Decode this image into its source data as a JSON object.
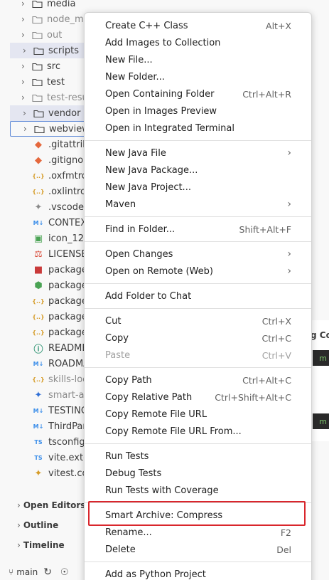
{
  "explorer": {
    "rows": [
      {
        "label": "media",
        "kind": "folder",
        "dim": false
      },
      {
        "label": "node_m",
        "kind": "folder",
        "dim": true
      },
      {
        "label": "out",
        "kind": "folder",
        "dim": true
      },
      {
        "label": "scripts",
        "kind": "folder",
        "dim": false,
        "selected": true
      },
      {
        "label": "src",
        "kind": "folder",
        "dim": false
      },
      {
        "label": "test",
        "kind": "folder",
        "dim": false
      },
      {
        "label": "test-resu",
        "kind": "folder",
        "dim": true
      },
      {
        "label": "vendor",
        "kind": "folder",
        "dim": false,
        "selected": true
      },
      {
        "label": "webview",
        "kind": "folder",
        "dim": false,
        "focused": true
      },
      {
        "label": ".gitattrib",
        "kind": "file",
        "icon": "git",
        "color": "#e5683d"
      },
      {
        "label": ".gitignor",
        "kind": "file",
        "icon": "git",
        "color": "#e5683d"
      },
      {
        "label": ".oxfmtrc",
        "kind": "file",
        "icon": "json",
        "color": "#d69c28"
      },
      {
        "label": ".oxlintrc.",
        "kind": "file",
        "icon": "json",
        "color": "#d69c28"
      },
      {
        "label": ".vscodeig",
        "kind": "file",
        "icon": "vscode",
        "color": "#8a8a8a"
      },
      {
        "label": "CONTEX",
        "kind": "file",
        "icon": "md",
        "color": "#3b8eea"
      },
      {
        "label": "icon_128",
        "kind": "file",
        "icon": "image",
        "color": "#4aa354"
      },
      {
        "label": "LICENSE",
        "kind": "file",
        "icon": "license",
        "color": "#d94a38"
      },
      {
        "label": "package",
        "kind": "file",
        "icon": "npm",
        "color": "#c93a3a"
      },
      {
        "label": "package",
        "kind": "file",
        "icon": "node",
        "color": "#4aa354"
      },
      {
        "label": "package",
        "kind": "file",
        "icon": "json",
        "color": "#d69c28"
      },
      {
        "label": "package",
        "kind": "file",
        "icon": "json",
        "color": "#d69c28"
      },
      {
        "label": "package",
        "kind": "file",
        "icon": "json",
        "color": "#d69c28"
      },
      {
        "label": "README",
        "kind": "file",
        "icon": "info",
        "color": "#3a9a7a"
      },
      {
        "label": "ROADMA",
        "kind": "file",
        "icon": "md",
        "color": "#3b8eea"
      },
      {
        "label": "skills-loc",
        "kind": "file",
        "icon": "json",
        "color": "#d69c28",
        "dim": true
      },
      {
        "label": "smart-ar",
        "kind": "file",
        "icon": "vscode",
        "color": "#2f6fd6",
        "dim": true
      },
      {
        "label": "TESTING",
        "kind": "file",
        "icon": "md",
        "color": "#3b8eea"
      },
      {
        "label": "ThirdPar",
        "kind": "file",
        "icon": "md",
        "color": "#3b8eea"
      },
      {
        "label": "tsconfig.",
        "kind": "file",
        "icon": "tsconfig",
        "color": "#3b8eea"
      },
      {
        "label": "vite.exte",
        "kind": "file",
        "icon": "ts",
        "color": "#3b8eea"
      },
      {
        "label": "vitest.co",
        "kind": "file",
        "icon": "vitest",
        "color": "#d69c28"
      }
    ],
    "sections": [
      "Open Editors",
      "Outline",
      "Timeline"
    ]
  },
  "statusbar": {
    "branch": "main"
  },
  "editor": {
    "fragment": "g Co"
  },
  "context_menu": {
    "groups": [
      [
        {
          "label": "Create C++ Class",
          "kb": "Alt+X"
        },
        {
          "label": "Add Images to Collection",
          "kb": ""
        },
        {
          "label": "New File...",
          "kb": ""
        },
        {
          "label": "New Folder...",
          "kb": ""
        },
        {
          "label": "Open Containing Folder",
          "kb": "Ctrl+Alt+R"
        },
        {
          "label": "Open in Images Preview",
          "kb": ""
        },
        {
          "label": "Open in Integrated Terminal",
          "kb": ""
        }
      ],
      [
        {
          "label": "New Java File",
          "kb": "",
          "submenu": true
        },
        {
          "label": "New Java Package...",
          "kb": ""
        },
        {
          "label": "New Java Project...",
          "kb": ""
        },
        {
          "label": "Maven",
          "kb": "",
          "submenu": true
        }
      ],
      [
        {
          "label": "Find in Folder...",
          "kb": "Shift+Alt+F"
        }
      ],
      [
        {
          "label": "Open Changes",
          "kb": "",
          "submenu": true
        },
        {
          "label": "Open on Remote (Web)",
          "kb": "",
          "submenu": true
        }
      ],
      [
        {
          "label": "Add Folder to Chat",
          "kb": ""
        }
      ],
      [
        {
          "label": "Cut",
          "kb": "Ctrl+X"
        },
        {
          "label": "Copy",
          "kb": "Ctrl+C"
        },
        {
          "label": "Paste",
          "kb": "Ctrl+V",
          "disabled": true
        }
      ],
      [
        {
          "label": "Copy Path",
          "kb": "Ctrl+Alt+C"
        },
        {
          "label": "Copy Relative Path",
          "kb": "Ctrl+Shift+Alt+C"
        },
        {
          "label": "Copy Remote File URL",
          "kb": ""
        },
        {
          "label": "Copy Remote File URL From...",
          "kb": ""
        }
      ],
      [
        {
          "label": "Run Tests",
          "kb": ""
        },
        {
          "label": "Debug Tests",
          "kb": ""
        },
        {
          "label": "Run Tests with Coverage",
          "kb": ""
        }
      ],
      [
        {
          "label": "Smart Archive: Compress",
          "kb": ""
        },
        {
          "label": "Rename...",
          "kb": "F2"
        },
        {
          "label": "Delete",
          "kb": "Del"
        }
      ],
      [
        {
          "label": "Add as Python Project",
          "kb": ""
        }
      ]
    ]
  }
}
